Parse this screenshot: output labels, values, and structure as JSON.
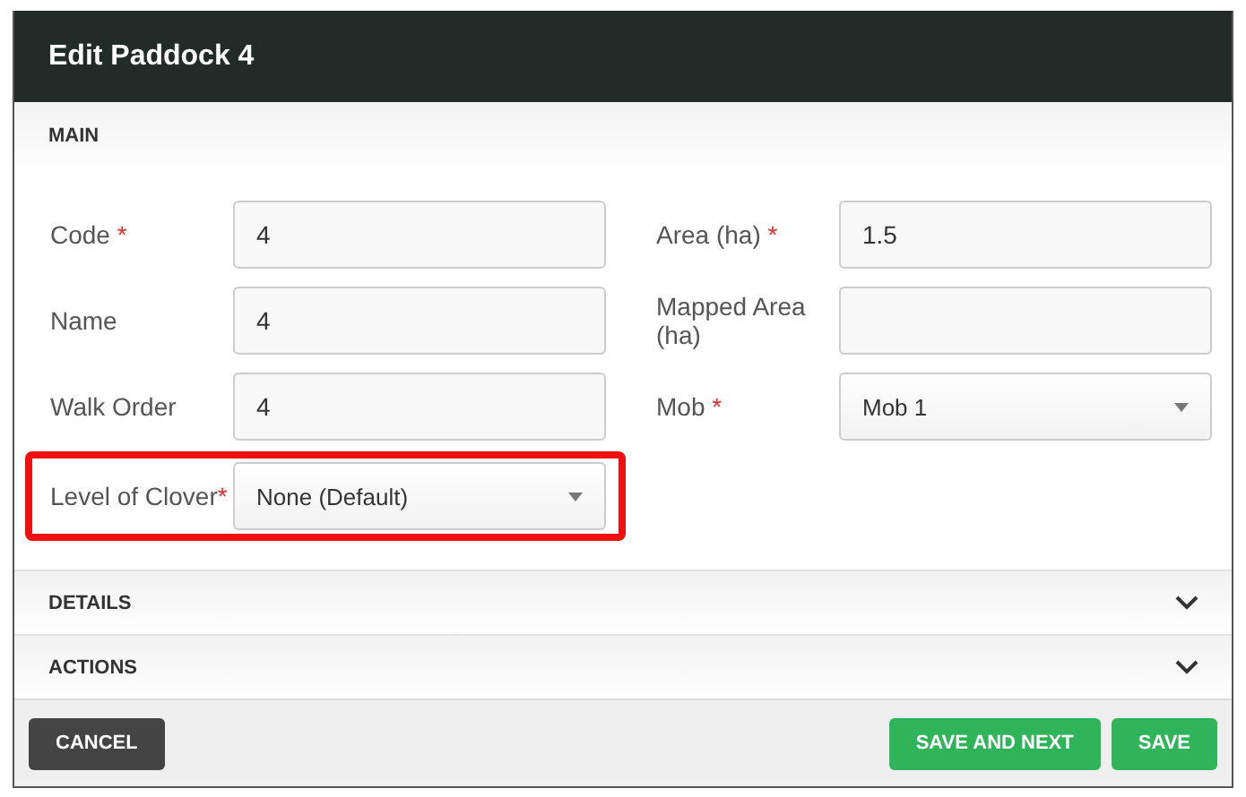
{
  "dialog": {
    "title": "Edit Paddock 4"
  },
  "main_section": {
    "title": "MAIN",
    "rows": [
      [
        {
          "label": "Code",
          "required_mark": "*",
          "kind": "text",
          "value": "4"
        },
        {
          "label": "Area (ha)",
          "required_mark": "*",
          "kind": "text",
          "value": "1.5"
        }
      ],
      [
        {
          "label": "Name",
          "kind": "text",
          "value": "4"
        },
        {
          "label": "Mapped Area (ha)",
          "kind": "text"
        }
      ],
      [
        {
          "label": "Walk Order",
          "kind": "text",
          "value": "4"
        },
        {
          "label": "Mob",
          "required_mark": "*",
          "kind": "select",
          "value": "Mob 1"
        }
      ],
      [
        {
          "label": "Level of Clover",
          "required_mark": "*",
          "kind": "select",
          "value": "None (Default)",
          "highlighted": true
        }
      ]
    ]
  },
  "sections": [
    {
      "title": "DETAILS",
      "expanded": false
    },
    {
      "title": "ACTIONS",
      "expanded": false
    }
  ],
  "buttons": [
    {
      "label": "CANCEL",
      "kind": "secondary"
    },
    {
      "label": "SAVE AND NEXT",
      "kind": "primary"
    },
    {
      "label": "SAVE",
      "kind": "primary"
    }
  ]
}
